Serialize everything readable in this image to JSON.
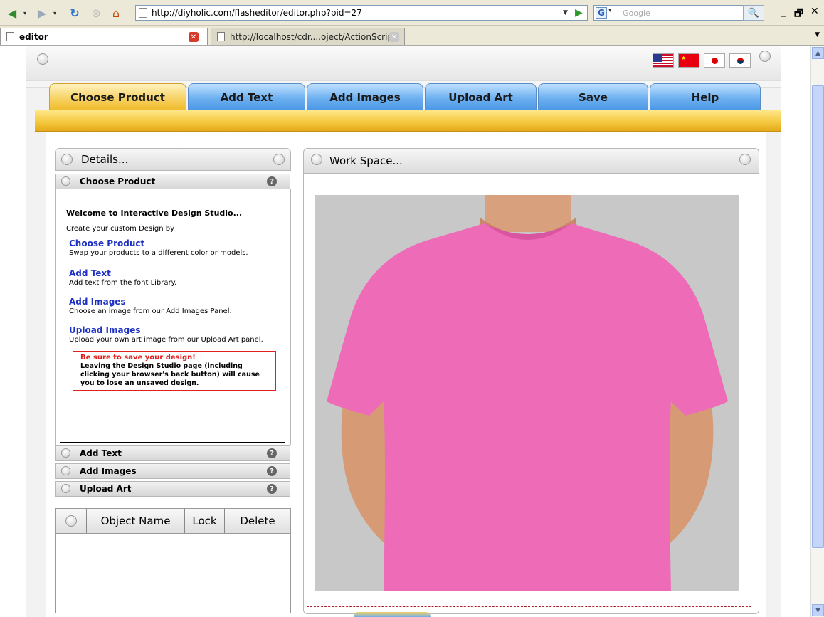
{
  "browser": {
    "url": "http://diyholic.com/flasheditor/editor.php?pid=27",
    "search_placeholder": "Google",
    "tabs": [
      {
        "label": "editor"
      },
      {
        "label": "http://localhost/cdr....oject/ActionScript/"
      }
    ]
  },
  "nav": {
    "tabs": [
      "Choose Product",
      "Add Text",
      "Add Images",
      "Upload Art",
      "Save",
      "Help"
    ],
    "active": "Choose Product"
  },
  "details": {
    "title": "Details...",
    "sections": [
      "Choose Product",
      "Add Text",
      "Add Images",
      "Upload Art"
    ],
    "help_glyph": "?"
  },
  "welcome": {
    "heading": "Welcome to Interactive Design Studio...",
    "intro": "Create your custom Design by",
    "items": [
      {
        "title": "Choose Product",
        "desc": "Swap your products to a different color or models."
      },
      {
        "title": "Add Text",
        "desc": "Add text from the font Library."
      },
      {
        "title": "Add Images",
        "desc": "Choose an image from our Add Images Panel."
      },
      {
        "title": "Upload Images",
        "desc": "Upload your own art image from our Upload Art panel."
      }
    ],
    "warning_title": "Be sure to save your design!",
    "warning_text": "Leaving the Design Studio page (including clicking your browser's back button) will cause you to lose an unsaved design."
  },
  "objects": {
    "columns": [
      "Object Name",
      "Lock",
      "Delete"
    ]
  },
  "workspace": {
    "title": "Work Space...",
    "shirt_color": "#ee6bb8"
  },
  "colors": {
    "accent_gold": "#f3c63b",
    "accent_blue": "#6db0f0",
    "link_blue": "#1b2fc4",
    "warning_red": "#e02020"
  }
}
